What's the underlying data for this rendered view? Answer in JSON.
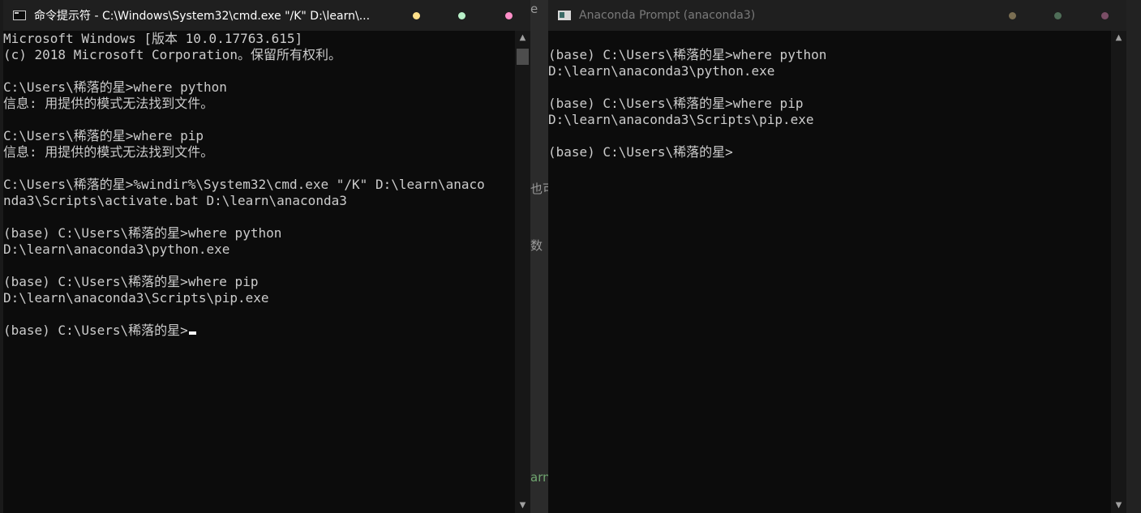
{
  "left_window": {
    "title": "命令提示符 - C:\\Windows\\System32\\cmd.exe  \"/K\" D:\\learn\\...",
    "lines": [
      "Microsoft Windows [版本 10.0.17763.615]",
      "(c) 2018 Microsoft Corporation。保留所有权利。",
      "",
      "C:\\Users\\稀落的星>where python",
      "信息: 用提供的模式无法找到文件。",
      "",
      "C:\\Users\\稀落的星>where pip",
      "信息: 用提供的模式无法找到文件。",
      "",
      "C:\\Users\\稀落的星>%windir%\\System32\\cmd.exe \"/K\" D:\\learn\\anaco",
      "nda3\\Scripts\\activate.bat D:\\learn\\anaconda3",
      "",
      "(base) C:\\Users\\稀落的星>where python",
      "D:\\learn\\anaconda3\\python.exe",
      "",
      "(base) C:\\Users\\稀落的星>where pip",
      "D:\\learn\\anaconda3\\Scripts\\pip.exe",
      "",
      "(base) C:\\Users\\稀落的星>"
    ],
    "title_dot_colors": [
      "#ffe08a",
      "#b8f0c8",
      "#ff8ec8"
    ]
  },
  "right_window": {
    "title": "Anaconda Prompt (anaconda3)",
    "lines": [
      "",
      "(base) C:\\Users\\稀落的星>where python",
      "D:\\learn\\anaconda3\\python.exe",
      "",
      "(base) C:\\Users\\稀落的星>where pip",
      "D:\\learn\\anaconda3\\Scripts\\pip.exe",
      "",
      "(base) C:\\Users\\稀落的星>"
    ],
    "title_dot_colors": [
      "#7a6e52",
      "#4f6e58",
      "#7a4e66"
    ]
  },
  "background_fragments": [
    "e",
    "也可",
    "数",
    "arn"
  ],
  "scroll_icons": {
    "up": "chevron-up-icon",
    "down": "chevron-down-icon"
  }
}
